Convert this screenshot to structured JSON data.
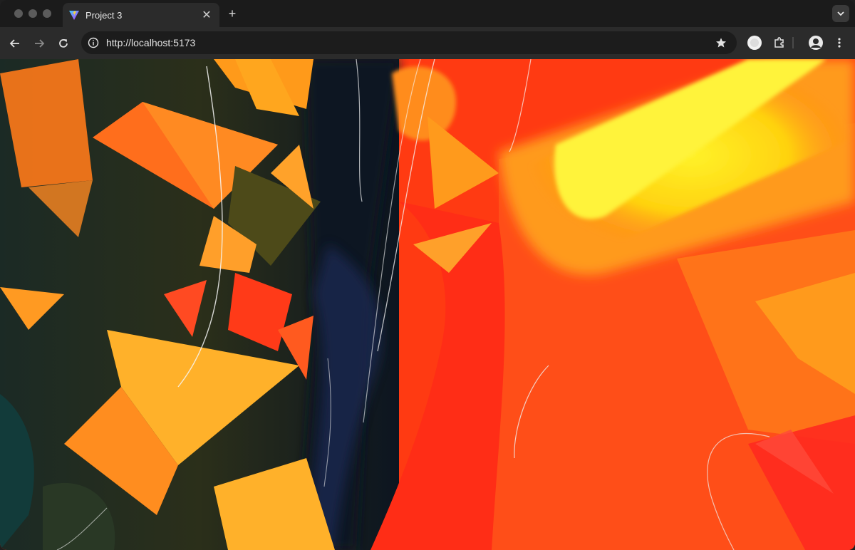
{
  "window": {
    "traffic_lights": [
      "close",
      "minimize",
      "zoom"
    ]
  },
  "tabs": [
    {
      "title": "Project 3",
      "favicon": "vite-logo-icon",
      "active": true
    }
  ],
  "toolbar": {
    "url": "http://localhost:5173",
    "back_icon": "back-arrow-icon",
    "forward_icon": "forward-arrow-icon",
    "reload_icon": "reload-icon",
    "site_info_icon": "info-icon",
    "bookmark_icon": "star-icon",
    "extension_icon": "puzzle-icon",
    "menu_icon": "kebab-menu-icon"
  },
  "colors": {
    "accent_yellow": "#ffe81a",
    "accent_red": "#ff3a12",
    "accent_orange": "#ff7a1a",
    "dark_navy": "#0d1420"
  }
}
